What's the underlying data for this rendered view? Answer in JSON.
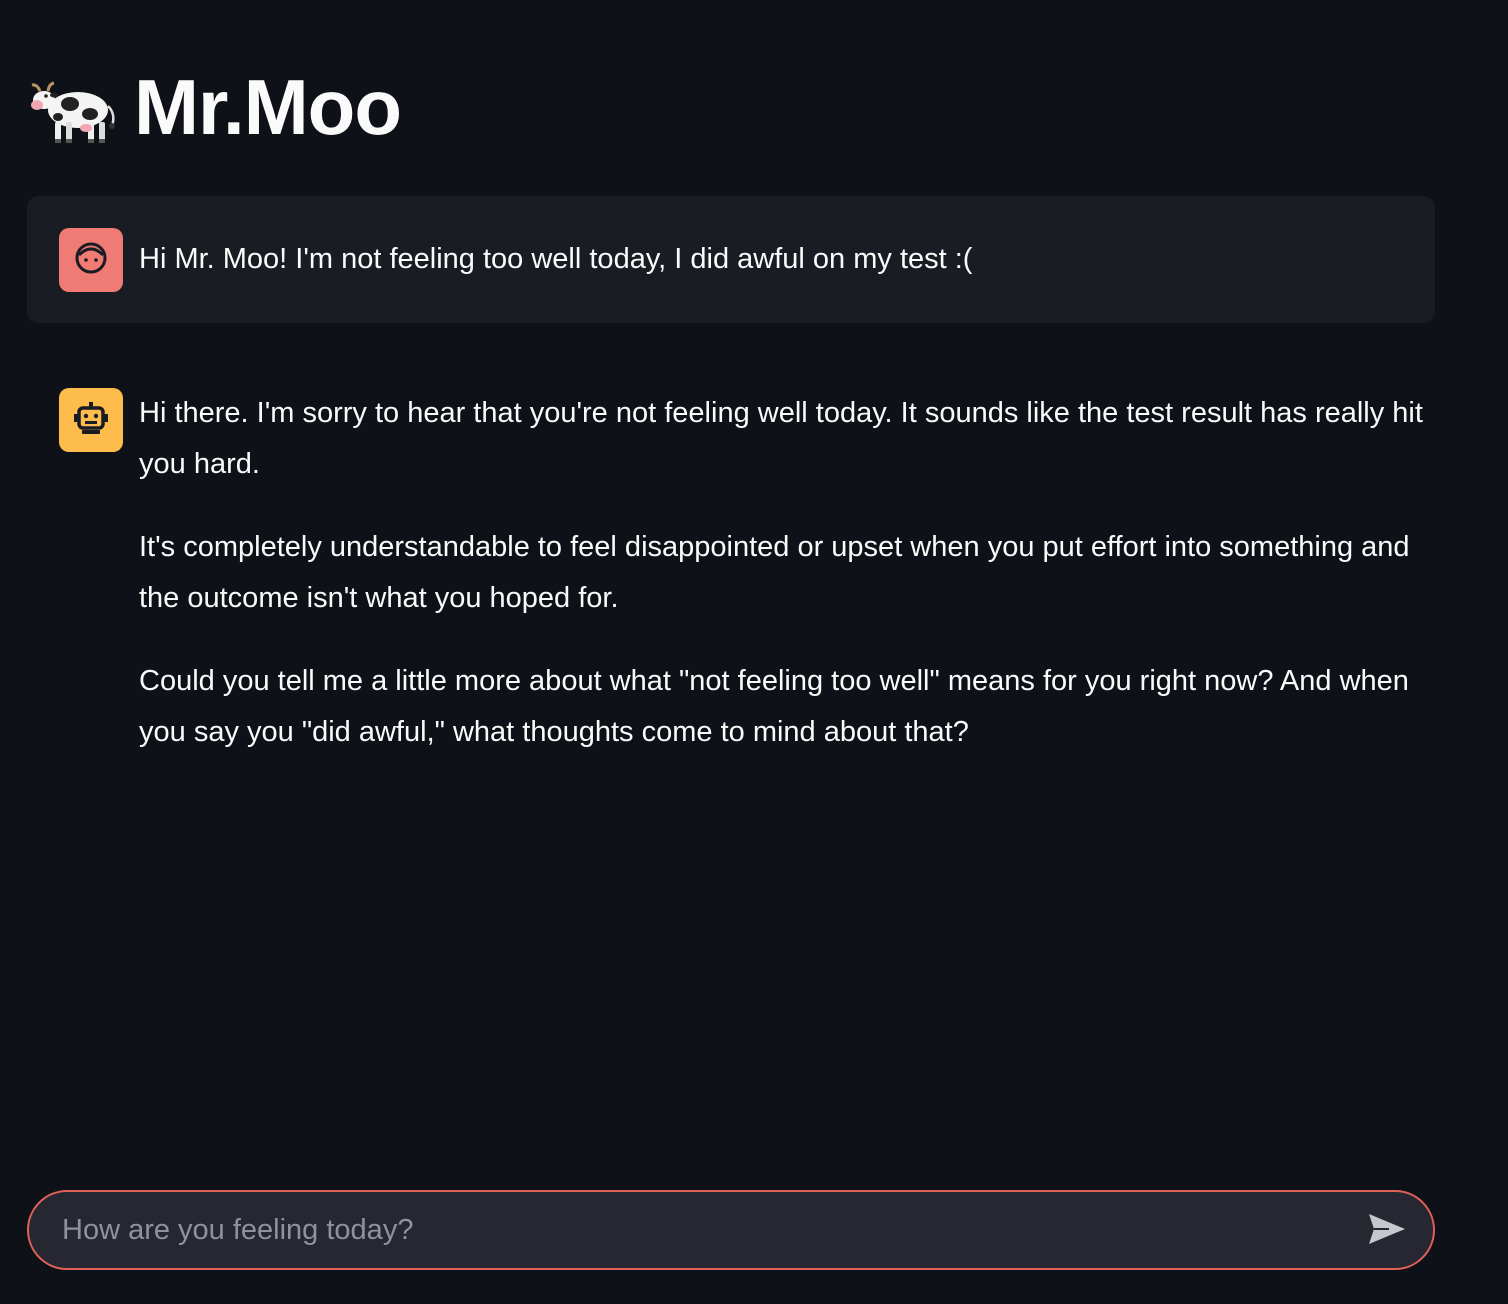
{
  "header": {
    "title": "Mr.Moo",
    "icon": "cow-icon"
  },
  "messages": [
    {
      "role": "user",
      "avatar": "user-face-icon",
      "avatar_color": "#f07a74",
      "paragraphs": [
        "Hi Mr. Moo! I'm not feeling too well today, I did awful on my test :("
      ]
    },
    {
      "role": "assistant",
      "avatar": "robot-icon",
      "avatar_color": "#fdbc4b",
      "paragraphs": [
        "Hi there. I'm sorry to hear that you're not feeling well today. It sounds like the test result has really hit you hard.",
        "It's completely understandable to feel disappointed or upset when you put effort into something and the outcome isn't what you hoped for.",
        "Could you tell me a little more about what \"not feeling too well\" means for you right now? And when you say you \"did awful,\" what thoughts come to mind about that?"
      ]
    }
  ],
  "chat_input": {
    "placeholder": "How are you feeling today?",
    "value": "",
    "send_icon": "send-icon",
    "border_color": "#e0605a"
  },
  "colors": {
    "background": "#0e1117",
    "user_bubble": "#1a1c24",
    "input_background": "#262730"
  }
}
